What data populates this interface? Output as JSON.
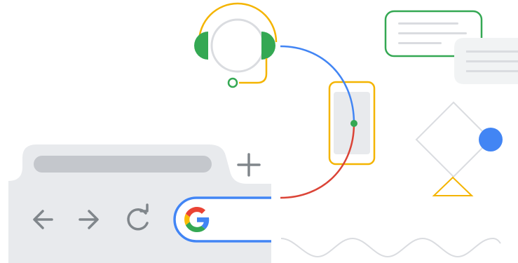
{
  "illustration": {
    "browser": {
      "tab": {
        "label": ""
      },
      "new_tab_symbol": "+",
      "toolbar": {
        "back_icon": "arrow-left-icon",
        "forward_icon": "arrow-right-icon",
        "reload_icon": "reload-icon"
      },
      "omnibox": {
        "logo": "G",
        "value": ""
      }
    },
    "support": {
      "icon": "headset-icon"
    },
    "device": {
      "icon": "phone-icon"
    },
    "chat": {
      "icon": "chat-bubble-icon"
    },
    "shapes": {
      "icons": [
        "diamond-icon",
        "circle-icon",
        "triangle-icon",
        "wave-icon"
      ]
    },
    "colors": {
      "blue": "#4285f4",
      "red": "#db4437",
      "yellow": "#f4b400",
      "green": "#34a853",
      "grey_light": "#e8eaed",
      "grey_mid": "#dadce0",
      "grey_icon": "#80868b",
      "grey_bar": "#c4c7cc"
    }
  }
}
